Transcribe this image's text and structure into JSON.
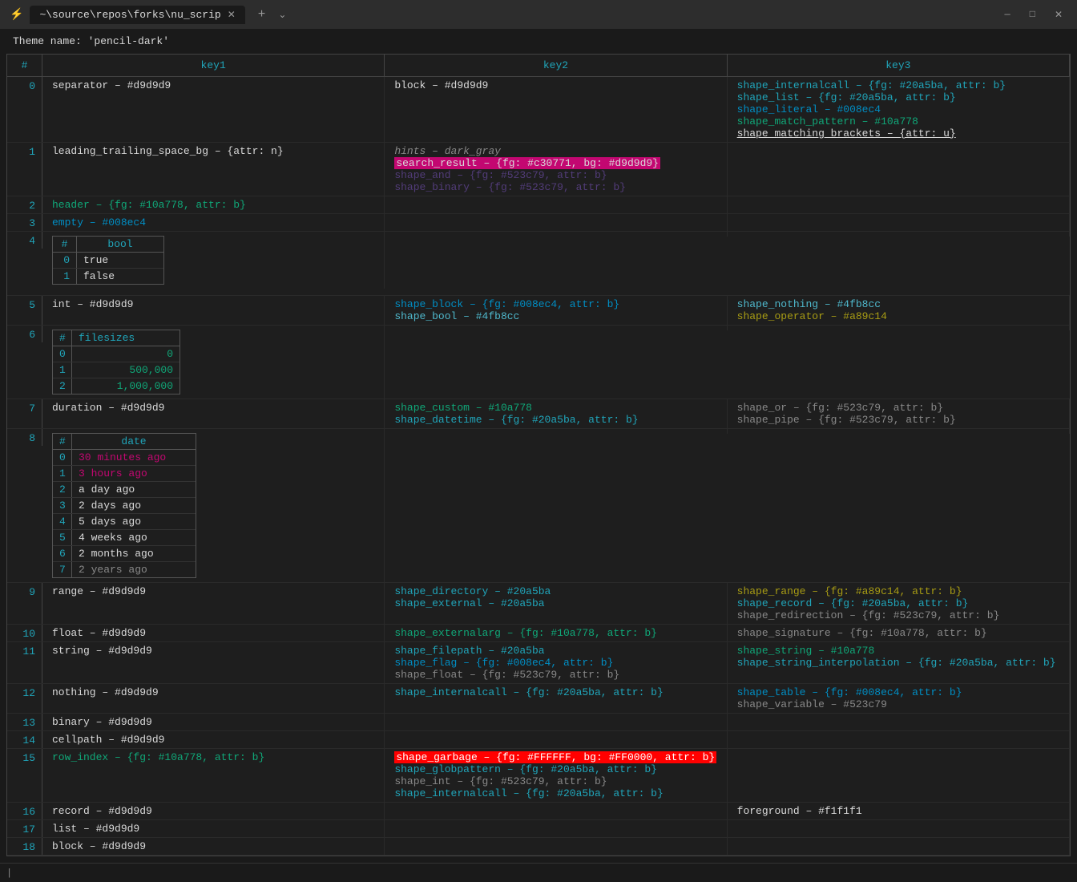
{
  "titlebar": {
    "icon": "≡",
    "tab_label": "~\\source\\repos\\forks\\nu_scrip",
    "new_tab": "+",
    "dropdown": "⌄",
    "btn_minimize": "—",
    "btn_maximize": "□",
    "btn_close": "✕"
  },
  "theme_line": "Theme name: 'pencil-dark'",
  "table": {
    "headers": [
      "#",
      "key1",
      "key2",
      "key3"
    ],
    "rows": [
      {
        "num": "0",
        "col1": "separator – #d9d9d9",
        "col2": "block – #d9d9d9",
        "col3": "shape_internalcall – {fg: #20a5ba, attr: b}\nshape_list – {fg: #20a5ba, attr: b}\nshape_literal – #008ec4\nshape_match_pattern – #10a778\nshape_matching_brackets – {attr: u}"
      }
    ]
  },
  "bottom_cursor": "|"
}
